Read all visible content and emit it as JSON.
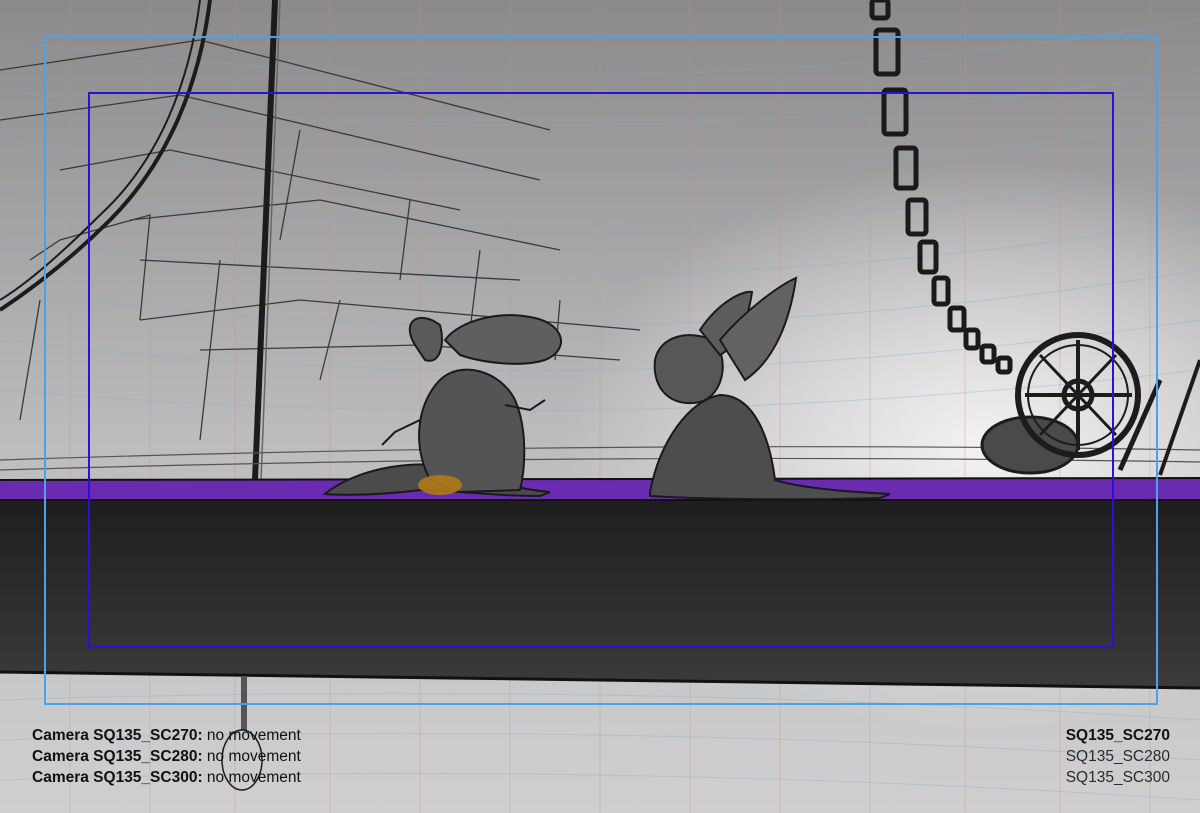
{
  "camera_notes": [
    {
      "camera": "Camera SQ135_SC270:",
      "note": "no movement"
    },
    {
      "camera": "Camera SQ135_SC280:",
      "note": "no movement"
    },
    {
      "camera": "Camera SQ135_SC300:",
      "note": "no movement"
    }
  ],
  "scene_ids": {
    "current": "SQ135_SC270",
    "others": [
      "SQ135_SC280",
      "SQ135_SC300"
    ]
  },
  "colors": {
    "outer_frame": "#4aa3e8",
    "inner_frame": "#2a10d8",
    "ledge_highlight": "#6a2bb0",
    "accent_orange": "#b07a1a"
  }
}
